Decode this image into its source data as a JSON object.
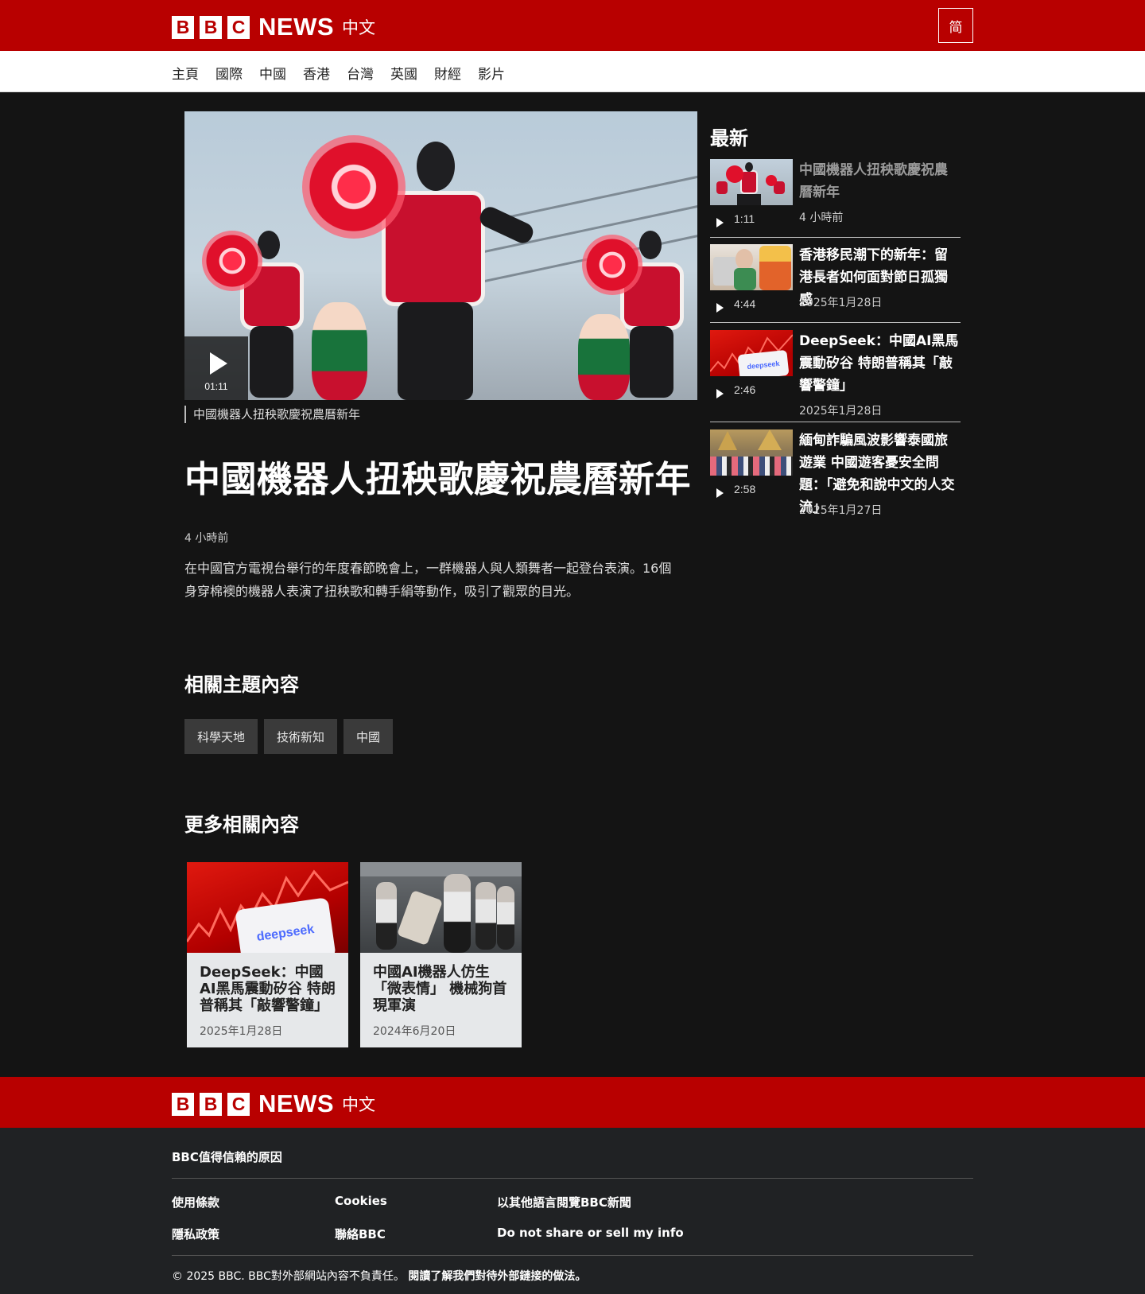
{
  "header": {
    "logo_letters": [
      "B",
      "B",
      "C"
    ],
    "logo_news": "NEWS",
    "logo_lang": "中文",
    "variant_toggle": "简"
  },
  "nav": {
    "items": [
      "主頁",
      "國際",
      "中國",
      "香港",
      "台灣",
      "英國",
      "財經",
      "影片"
    ]
  },
  "video": {
    "duration": "01:11",
    "caption": "中國機器人扭秧歌慶祝農曆新年"
  },
  "article": {
    "headline": "中國機器人扭秧歌慶祝農曆新年",
    "timestamp": "4 小時前",
    "summary": "在中國官方電視台舉行的年度春節晚會上，一群機器人與人類舞者一起登台表演。16個身穿棉襖的機器人表演了扭秧歌和轉手絹等動作，吸引了觀眾的目光。"
  },
  "topics": {
    "title": "相關主題內容",
    "tags": [
      "科學天地",
      "技術新知",
      "中國"
    ]
  },
  "more": {
    "title": "更多相關內容",
    "cards": [
      {
        "title": "DeepSeek：中國AI黑馬震動矽谷 特朗普稱其「敲響警鐘」",
        "date": "2025年1月28日",
        "thumb_text": "deepseek"
      },
      {
        "title": "中國AI機器人仿生「微表情」 機械狗首現軍演",
        "date": "2024年6月20日"
      }
    ]
  },
  "sidebar": {
    "heading": "最新",
    "items": [
      {
        "title": "中國機器人扭秧歌慶祝農曆新年",
        "duration": "1:11",
        "date": "4 小時前"
      },
      {
        "title": "香港移民潮下的新年：留港長者如何面對節日孤獨感",
        "duration": "4:44",
        "date": "2025年1月28日"
      },
      {
        "title": "DeepSeek：中國AI黑馬震動矽谷 特朗普稱其「敲響警鐘」",
        "duration": "2:46",
        "date": "2025年1月28日",
        "thumb_text": "deepseek"
      },
      {
        "title": "緬甸詐騙風波影響泰國旅遊業 中國遊客憂安全問題：「避免和說中文的人交流」",
        "duration": "2:58",
        "date": "2025年1月27日"
      }
    ]
  },
  "footer": {
    "trust": "BBC值得信賴的原因",
    "links": [
      "使用條款",
      "Cookies",
      "以其他語言閱覽BBC新聞",
      "隱私政策",
      "聯絡BBC",
      "Do not share or sell my info"
    ],
    "copyright": "© 2025 BBC. BBC對外部網站內容不負責任。",
    "external_link": "閱讀了解我們對待外部鏈接的做法。"
  },
  "colors": {
    "brand_red": "#b80000",
    "page_bg": "#141414",
    "footer_bg": "#202224"
  }
}
